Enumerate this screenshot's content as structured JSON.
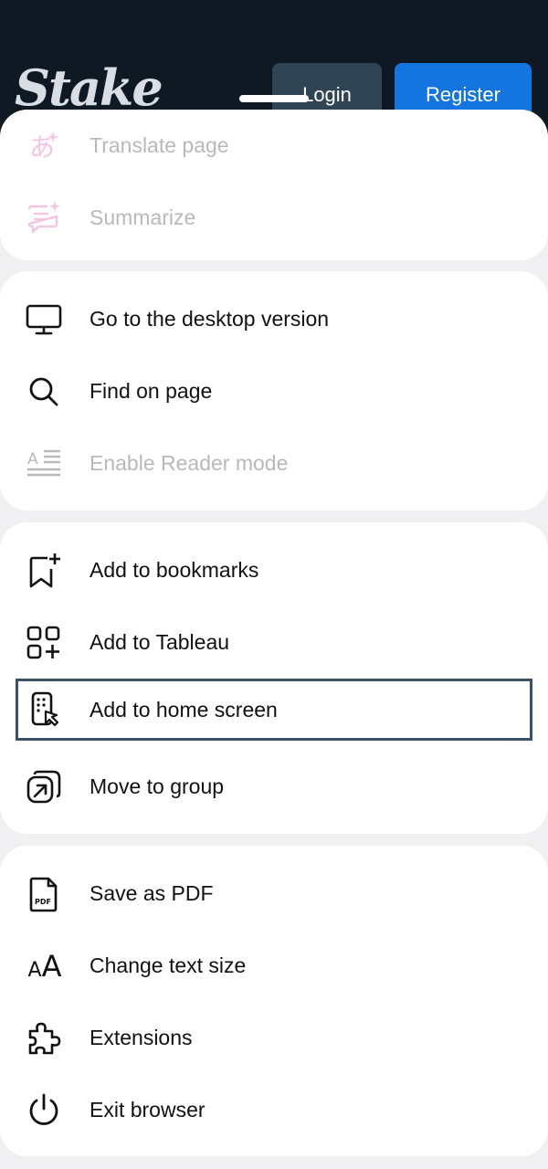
{
  "site": {
    "logo": "Stake",
    "login_label": "Login",
    "register_label": "Register"
  },
  "menu": {
    "group1": [
      {
        "label": "Translate page",
        "icon": "translate-icon",
        "disabled": true
      },
      {
        "label": "Summarize",
        "icon": "summarize-icon",
        "disabled": true
      }
    ],
    "group2": [
      {
        "label": "Go to the desktop version",
        "icon": "desktop-icon",
        "disabled": false
      },
      {
        "label": "Find on page",
        "icon": "search-icon",
        "disabled": false
      },
      {
        "label": "Enable Reader mode",
        "icon": "reader-mode-icon",
        "disabled": true
      }
    ],
    "group3": [
      {
        "label": "Add to bookmarks",
        "icon": "bookmark-add-icon",
        "disabled": false
      },
      {
        "label": "Add to Tableau",
        "icon": "tableau-add-icon",
        "disabled": false
      },
      {
        "label": "Add to home screen",
        "icon": "home-screen-add-icon",
        "disabled": false,
        "selected": true
      },
      {
        "label": "Move to group",
        "icon": "move-to-group-icon",
        "disabled": false
      }
    ],
    "group4": [
      {
        "label": "Save as PDF",
        "icon": "pdf-icon",
        "disabled": false,
        "icon_text": "PDF"
      },
      {
        "label": "Change text size",
        "icon": "text-size-icon",
        "disabled": false,
        "icon_text": "AA"
      },
      {
        "label": "Extensions",
        "icon": "puzzle-icon",
        "disabled": false
      },
      {
        "label": "Exit browser",
        "icon": "power-icon",
        "disabled": false
      }
    ]
  },
  "colors": {
    "header_bg": "#0f1923",
    "register_bg": "#1475e1",
    "login_bg": "#2f4553",
    "disabled_text": "#b9b9bd",
    "disabled_icon": "#f3c6e2",
    "highlight_border": "#3b5266"
  }
}
